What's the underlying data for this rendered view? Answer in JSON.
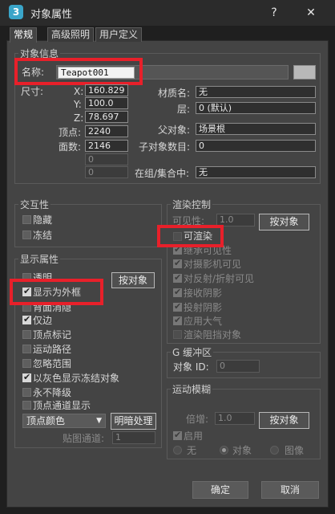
{
  "window": {
    "icon_letter": "3",
    "title": "对象属性",
    "help": "?",
    "close": "✕"
  },
  "tabs": [
    {
      "label": "常规"
    },
    {
      "label": "高级照明"
    },
    {
      "label": "用户定义"
    }
  ],
  "object_info": {
    "title": "对象信息",
    "name_label": "名称:",
    "name_value": "Teapot001",
    "dimensions_label": "尺寸:",
    "x_label": "X:",
    "x_value": "160.829",
    "y_label": "Y:",
    "y_value": "100.0",
    "z_label": "Z:",
    "z_value": "78.697",
    "vertices_label": "顶点:",
    "vertices_value": "2240",
    "faces_label": "面数:",
    "faces_value": "2146",
    "extra1_value": "0",
    "extra2_value": "0",
    "material_label": "材质名:",
    "material_value": "无",
    "layer_label": "层:",
    "layer_value": "0 (默认)",
    "parent_label": "父对象:",
    "parent_value": "场景根",
    "children_label": "子对象数目:",
    "children_value": "0",
    "group_label": "在组/集合中:",
    "group_value": "无"
  },
  "interaction": {
    "title": "交互性",
    "hide": "隐藏",
    "freeze": "冻结"
  },
  "display_props": {
    "title": "显示属性",
    "by_object": "按对象",
    "transparent": "透明",
    "display_as_box": "显示为外框",
    "backface_cull": "背面消隐",
    "edges_only": "仅边",
    "vertex_ticks": "顶点标记",
    "trajectory": "运动路径",
    "see_through": "忽略范围",
    "gray_frozen": "以灰色显示冻结对象",
    "never_degrade": "永不降级",
    "vertex_channel": "顶点通道显示",
    "vertex_color_select": "顶点颜色",
    "shaded_button": "明暗处理",
    "map_channel_label": "贴图通道:",
    "map_channel_value": "1"
  },
  "render_control": {
    "title": "渲染控制",
    "visibility_label": "可见性:",
    "visibility_value": "1.0",
    "by_object": "按对象",
    "renderable": "可渲染",
    "inherit_vis": "继承可见性",
    "visible_to_camera": "对摄影机可见",
    "visible_to_reflect": "对反射/折射可见",
    "receive_shadows": "接收阴影",
    "cast_shadows": "投射阴影",
    "apply_atmos": "应用大气",
    "render_occluded": "渲染阻挡对象"
  },
  "gbuffer": {
    "title": "G 缓冲区",
    "object_id_label": "对象 ID:",
    "object_id_value": "0"
  },
  "motion_blur": {
    "title": "运动模糊",
    "multiplier_label": "倍增:",
    "multiplier_value": "1.0",
    "by_object": "按对象",
    "enabled": "启用",
    "none": "无",
    "object": "对象",
    "image": "图像"
  },
  "footer": {
    "ok": "确定",
    "cancel": "取消"
  },
  "colors": {
    "highlight": "#e8202a",
    "dialog_bg": "#444444",
    "accent_icon": "#3aa5c9"
  }
}
